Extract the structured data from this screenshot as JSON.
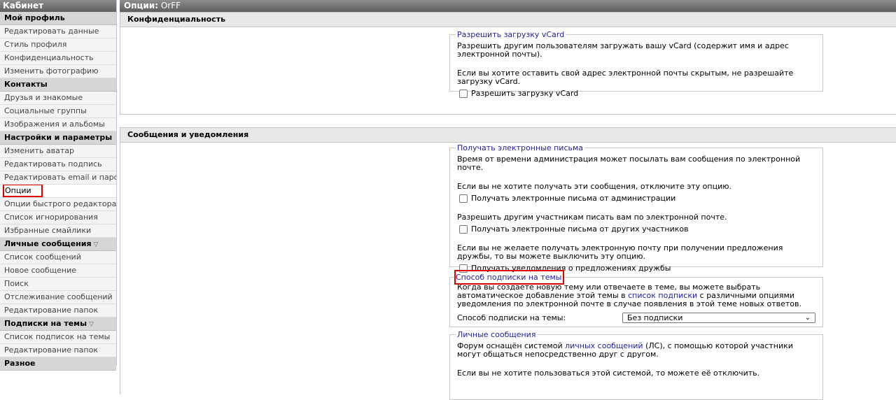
{
  "sidebar": {
    "title": "Кабинет",
    "groups": [
      {
        "title": "Мой профиль",
        "items": [
          "Редактировать данные",
          "Стиль профиля",
          "Конфиденциальность",
          "Изменить фотографию"
        ]
      },
      {
        "title": "Контакты",
        "items": [
          "Друзья и знакомые",
          "Социальные группы",
          "Изображения и альбомы"
        ]
      },
      {
        "title": "Настройки и параметры",
        "items": [
          "Изменить аватар",
          "Редактировать подпись",
          "Редактировать email и пароль",
          "Опции",
          "Опции быстрого редактора",
          "Список игнорирования",
          "Избранные смайлики"
        ]
      },
      {
        "title": "Личные сообщения",
        "items": [
          "Список сообщений",
          "Новое сообщение",
          "Поиск",
          "Отслеживание сообщений",
          "Редактирование папок"
        ]
      },
      {
        "title": "Подписки на темы",
        "items": [
          "Список подписок на темы",
          "Редактирование папок"
        ]
      },
      {
        "title": "Разное",
        "items": []
      }
    ],
    "active_item": "Опции",
    "collapse_icon": "triangle-down-icon"
  },
  "header": {
    "label": "Опции",
    "user": "OrFF"
  },
  "privacy": {
    "title": "Конфиденциальность",
    "vcard": {
      "legend": "Разрешить загрузку vCard",
      "desc": "Разрешить другим пользователям загружать вашу vCard (содержит имя и адрес электронной почты).",
      "note": "Если вы хотите оставить свой адрес электронной почты скрытым, не разрешайте загрузку vCard.",
      "checkbox": "Разрешить загрузку vCard"
    }
  },
  "messaging": {
    "title": "Сообщения и уведомления",
    "email": {
      "legend": "Получать электронные письма",
      "desc": "Время от времени администрация может посылать вам сообщения по электронной почте.",
      "admin_note": "Если вы не хотите получать эти сообщения, отключите эту опцию.",
      "admin_checkbox": "Получать электронные письма от администрации",
      "members_note": "Разрешить другим участникам писать вам по электронной почте.",
      "members_checkbox": "Получать электронные письма от других участников",
      "friend_note": "Если вы не желаете получать электронную почту при получении предложения дружбы, то вы можете выключить эту опцию.",
      "friend_checkbox": "Получать уведомления о предложениях дружбы"
    },
    "subscription": {
      "legend": "Способ подписки на темы",
      "desc_before": "Когда вы создаете новую тему или отвечаете в теме, вы можете выбрать автоматическое добавление этой темы в ",
      "link": "список подписки",
      "desc_after": " с различными опциями уведомления по электронной почте в случае появления в этой теме новых ответов.",
      "select_label": "Способ подписки на темы:",
      "select_value": "Без подписки"
    },
    "pm": {
      "legend": "Личные сообщения",
      "desc_before": "Форум оснащён системой ",
      "link": "личных сообщений",
      "desc_after": " (ЛС), с помощью которой участники могут общаться непосредственно друг с другом.",
      "note": "Если вы не хотите пользоваться этой системой, то можете её отключить."
    }
  },
  "colors": {
    "accent": "#22229c",
    "highlight": "#e00000",
    "header_bg": "#6f6f6f",
    "category_bg": "#d6d6d6"
  }
}
